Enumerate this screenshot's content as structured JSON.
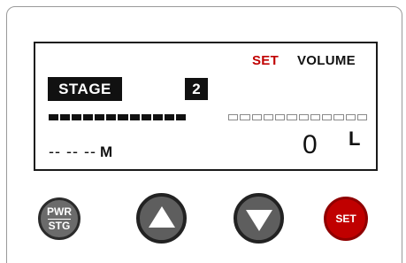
{
  "display": {
    "set_label": "SET",
    "volume_label": "VOLUME",
    "stage_label": "STAGE",
    "stage_value": "2",
    "distance_value": "-- -- --",
    "distance_unit": "M",
    "volume_value": "0",
    "volume_unit": "L",
    "left_bar_segments": 12,
    "left_bar_filled": 12,
    "right_bar_segments": 12,
    "right_bar_filled": 0
  },
  "buttons": {
    "power_stage_top": "PWR",
    "power_stage_bottom": "STG",
    "up_icon": "triangle-up-icon",
    "down_icon": "triangle-down-icon",
    "set_label": "SET"
  },
  "colors": {
    "accent_red": "#c00000",
    "lcd_ink": "#111111",
    "button_gray": "#5e5e5e"
  }
}
